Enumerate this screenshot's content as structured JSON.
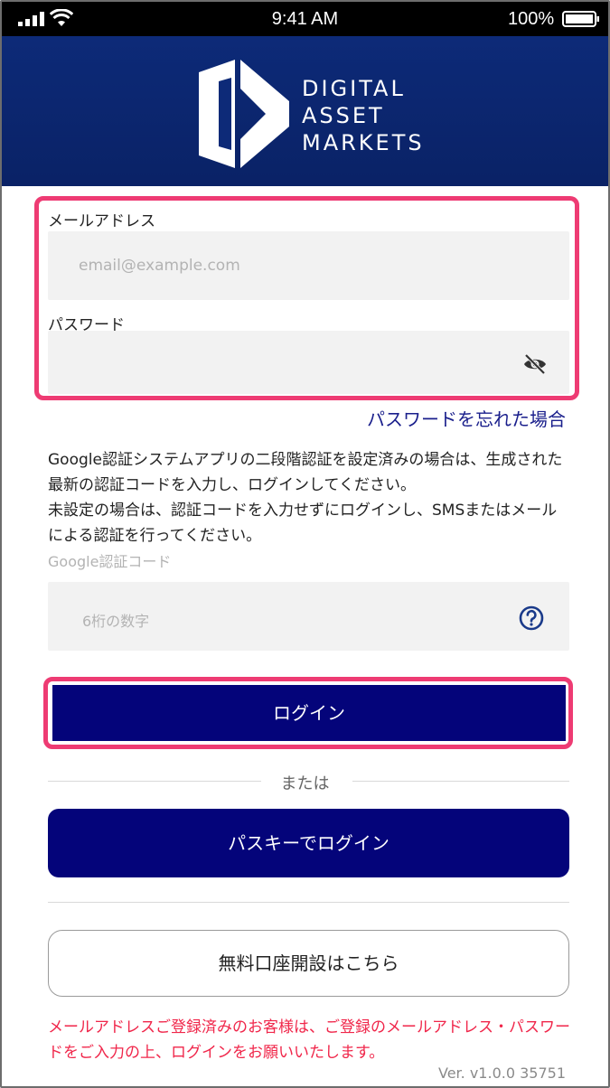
{
  "status_bar": {
    "time": "9:41 AM",
    "battery": "100%",
    "icons": [
      "signal-icon",
      "wifi-icon",
      "battery-icon"
    ]
  },
  "brand": {
    "line1": "Digital",
    "line2": "Asset",
    "line3": "Markets",
    "colors": {
      "header": "#0d2a78",
      "primary": "#04047a",
      "highlight": "#ee3b73",
      "notice": "#f0264a"
    }
  },
  "form": {
    "email_label": "メールアドレス",
    "email_placeholder": "email@example.com",
    "password_label": "パスワード",
    "password_value": "",
    "forgot_link": "パスワードを忘れた場合",
    "info": "Google認証システムアプリの二段階認証を設定済みの場合は、生成された最新の認証コードを入力し、ログインしてください。\n未設定の場合は、認証コードを入力せずにログインし、SMSまたはメールによる認証を行ってください。",
    "gcode_label": "Google認証コード",
    "gcode_placeholder": "6桁の数字"
  },
  "actions": {
    "login": "ログイン",
    "or": "または",
    "passkey_login": "パスキーでログイン",
    "open_account": "無料口座開設はこちら"
  },
  "footer": {
    "notice": "メールアドレスご登録済みのお客様は、ご登録のメールアドレス・パスワードをご入力の上、ログインをお願いいたします。",
    "version": "Ver. v1.0.0 35751"
  }
}
